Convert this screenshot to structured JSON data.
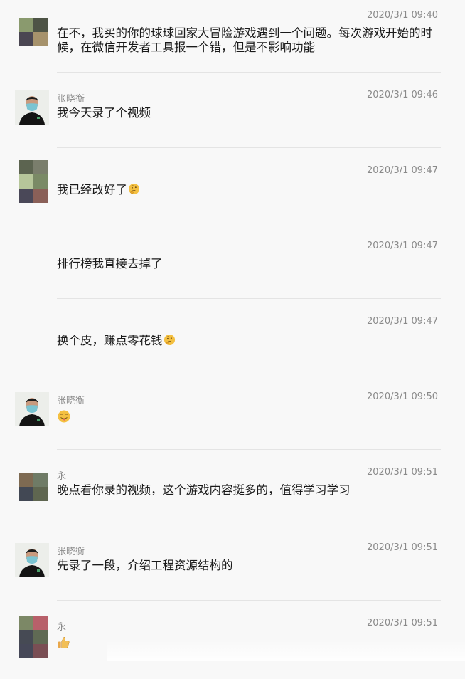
{
  "messages": [
    {
      "sender": "",
      "time": "2020/3/1 09:40",
      "text": "在不，我买的你的球球回家大冒险游戏遇到一个问题。每次游戏开始的时候，在微信开发者工具报一个错，但是不影响功能",
      "avatar": "mosaic-green-brown",
      "emoji": ""
    },
    {
      "sender": "张晓衡",
      "time": "2020/3/1 09:46",
      "text": "我今天录了个视频",
      "avatar": "photo-man-mask",
      "emoji": ""
    },
    {
      "sender": "",
      "time": "2020/3/1 09:47",
      "text": "我已经改好了",
      "avatar": "mosaic-green-tall",
      "emoji": "thinking-face"
    },
    {
      "sender": "",
      "time": "2020/3/1 09:47",
      "text": "排行榜我直接去掉了",
      "avatar": "",
      "emoji": ""
    },
    {
      "sender": "",
      "time": "2020/3/1 09:47",
      "text": "换个皮，赚点零花钱",
      "avatar": "",
      "emoji": "thinking-face"
    },
    {
      "sender": "张晓衡",
      "time": "2020/3/1 09:50",
      "text": "",
      "avatar": "photo-man-mask",
      "emoji": "tongue-out-face"
    },
    {
      "sender": "永",
      "time": "2020/3/1 09:51",
      "text": "晚点看你录的视频，这个游戏内容挺多的，值得学习学习",
      "avatar": "mosaic-brown-gray",
      "emoji": ""
    },
    {
      "sender": "张晓衡",
      "time": "2020/3/1 09:51",
      "text": "先录了一段，介绍工程资源结构的",
      "avatar": "photo-man-mask",
      "emoji": ""
    },
    {
      "sender": "永",
      "time": "2020/3/1 09:51",
      "text": "",
      "avatar": "mosaic-red-green-tall",
      "emoji": "thumbs-up"
    }
  ]
}
